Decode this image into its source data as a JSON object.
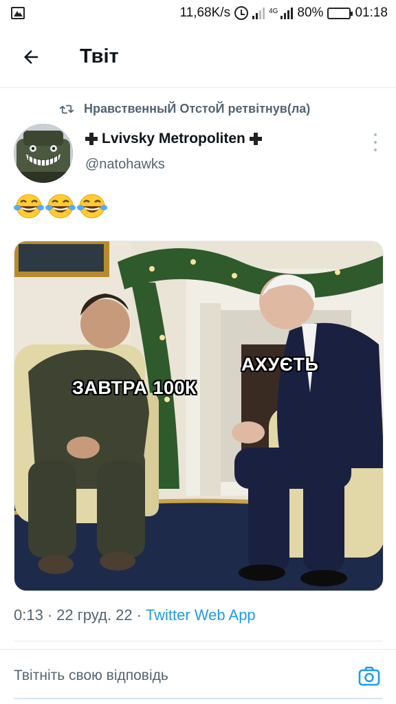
{
  "status_bar": {
    "net_speed": "11,68K/s",
    "battery_percent": "80%",
    "time": "01:18",
    "battery_level": 0.8,
    "battery_color": "#1bb40d"
  },
  "header": {
    "title": "Твіт",
    "back_icon": "arrow-left-icon"
  },
  "tweet": {
    "retweet_text": "НравственныЙ ОтстоЙ ретвітнув(ла)",
    "author_name": "Lvivsky Metropoliten",
    "author_handle": "@natohawks",
    "emoji_text": "😂😂😂",
    "media": {
      "left_caption": "ЗАВТРА 100К",
      "right_caption": "АХУЄТЬ"
    },
    "time": "0:13",
    "date": "22 груд. 22",
    "source": "Twitter Web App",
    "separator": "·"
  },
  "reply": {
    "placeholder": "Твітніть свою відповідь",
    "camera_icon": "camera-icon"
  },
  "colors": {
    "accent": "#1d9bf0",
    "secondary_text": "#536471",
    "divider": "#e6ecf0"
  }
}
